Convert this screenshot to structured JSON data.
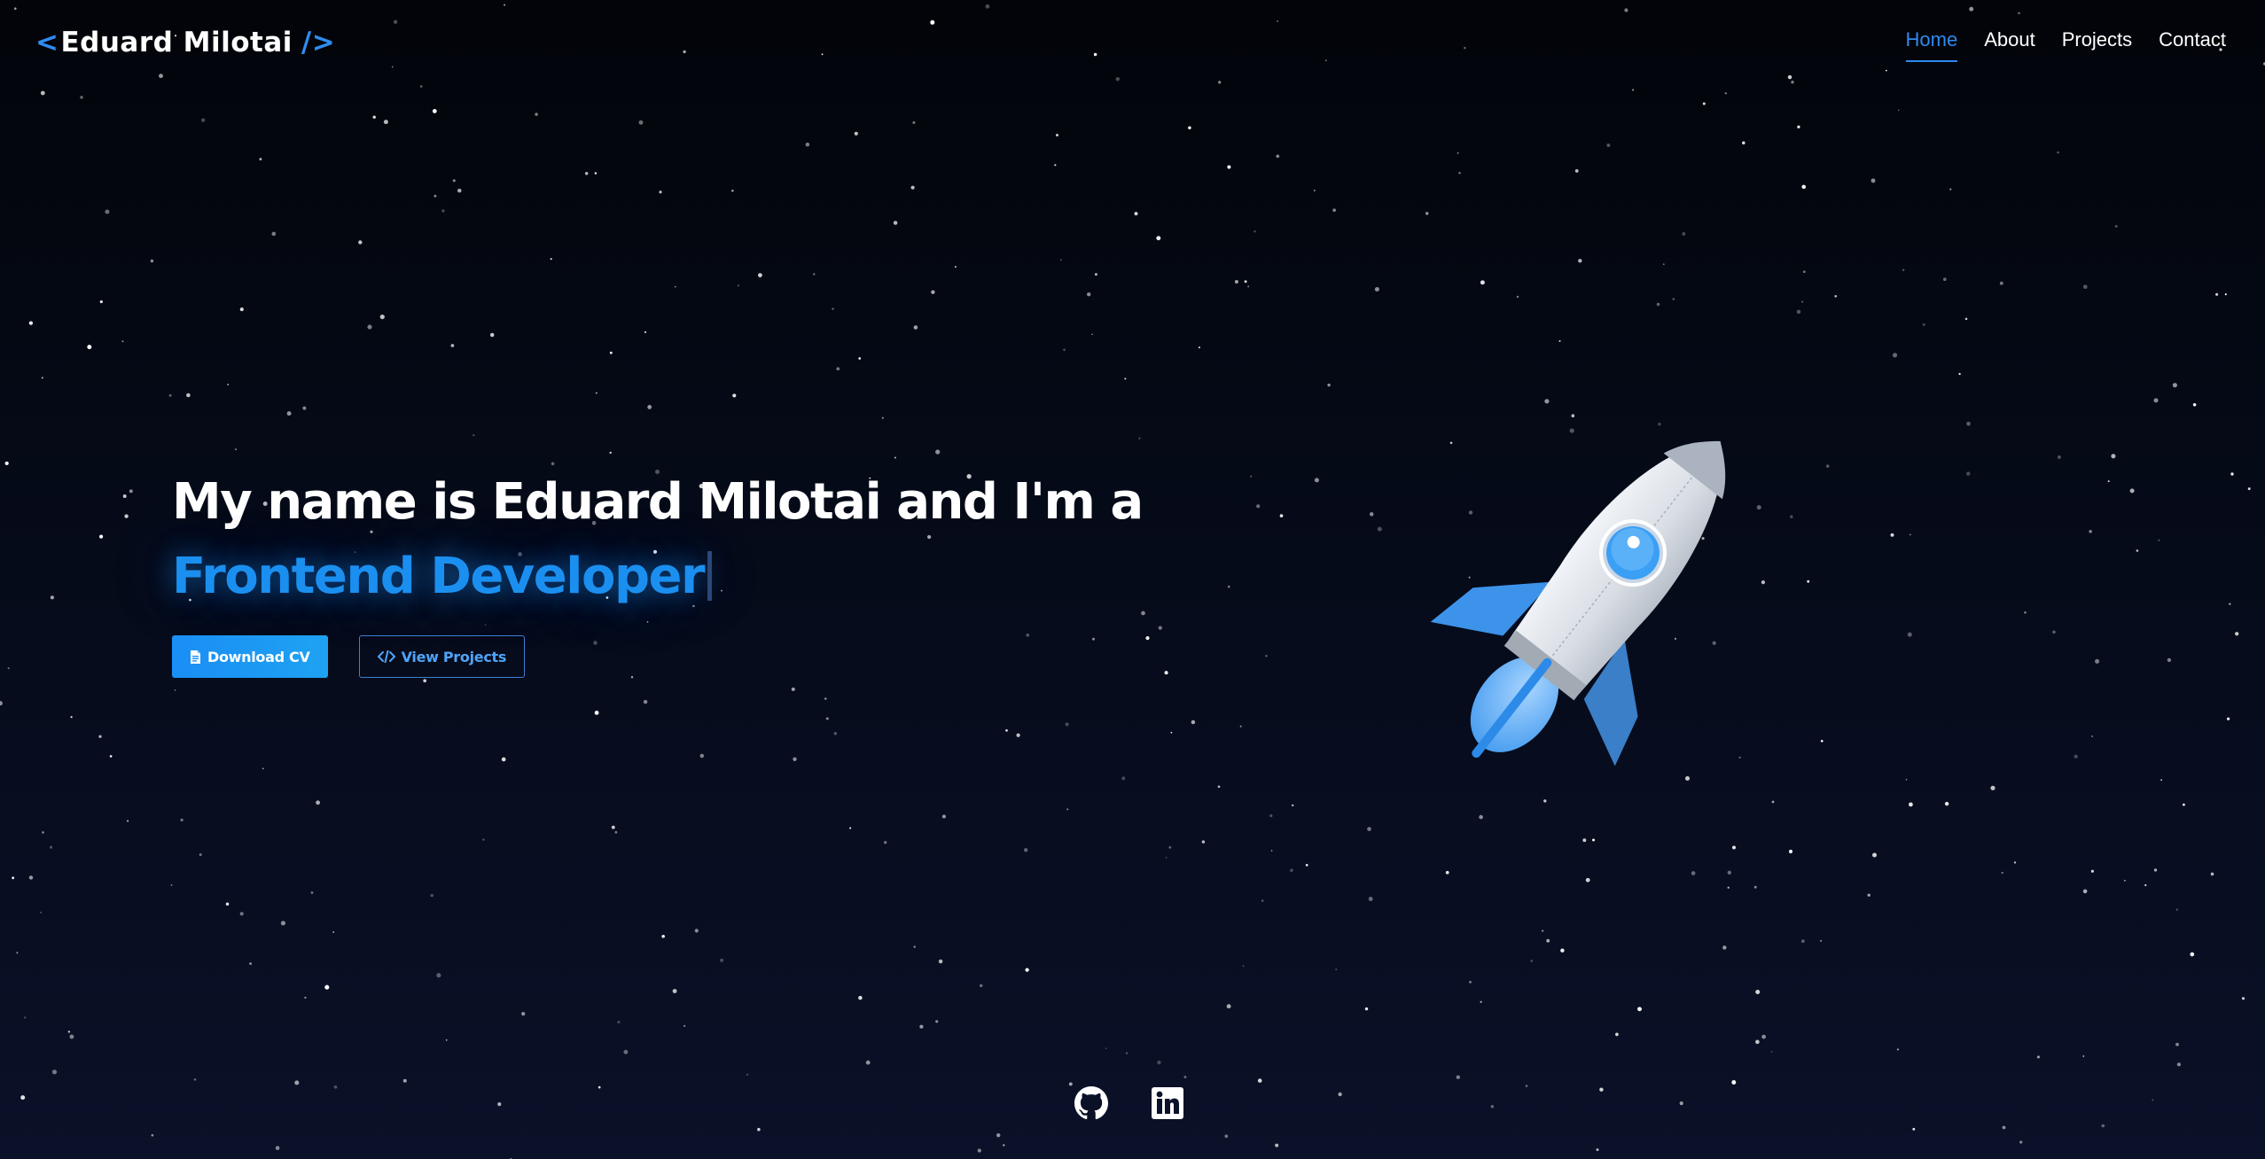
{
  "logo": {
    "open_bracket": "<",
    "name": "Eduard Milotai",
    "close_bracket": "/>"
  },
  "nav": {
    "items": [
      {
        "label": "Home",
        "active": true
      },
      {
        "label": "About",
        "active": false
      },
      {
        "label": "Projects",
        "active": false
      },
      {
        "label": "Contact",
        "active": false
      }
    ]
  },
  "hero": {
    "headline": "My name is Eduard Milotai and I'm a",
    "typed_text": "Frontend Developer",
    "buttons": {
      "download_cv": {
        "label": "Download CV",
        "icon": "file-icon"
      },
      "view_projects": {
        "label": "View Projects",
        "icon": "code-icon"
      }
    }
  },
  "illustration": {
    "icon": "rocket-icon"
  },
  "social": {
    "items": [
      {
        "name": "github",
        "icon": "github-icon"
      },
      {
        "name": "linkedin",
        "icon": "linkedin-icon"
      }
    ]
  },
  "colors": {
    "accent": "#2d8af0",
    "background_top": "#020409",
    "background_bottom": "#0a1128",
    "text": "#ffffff"
  }
}
